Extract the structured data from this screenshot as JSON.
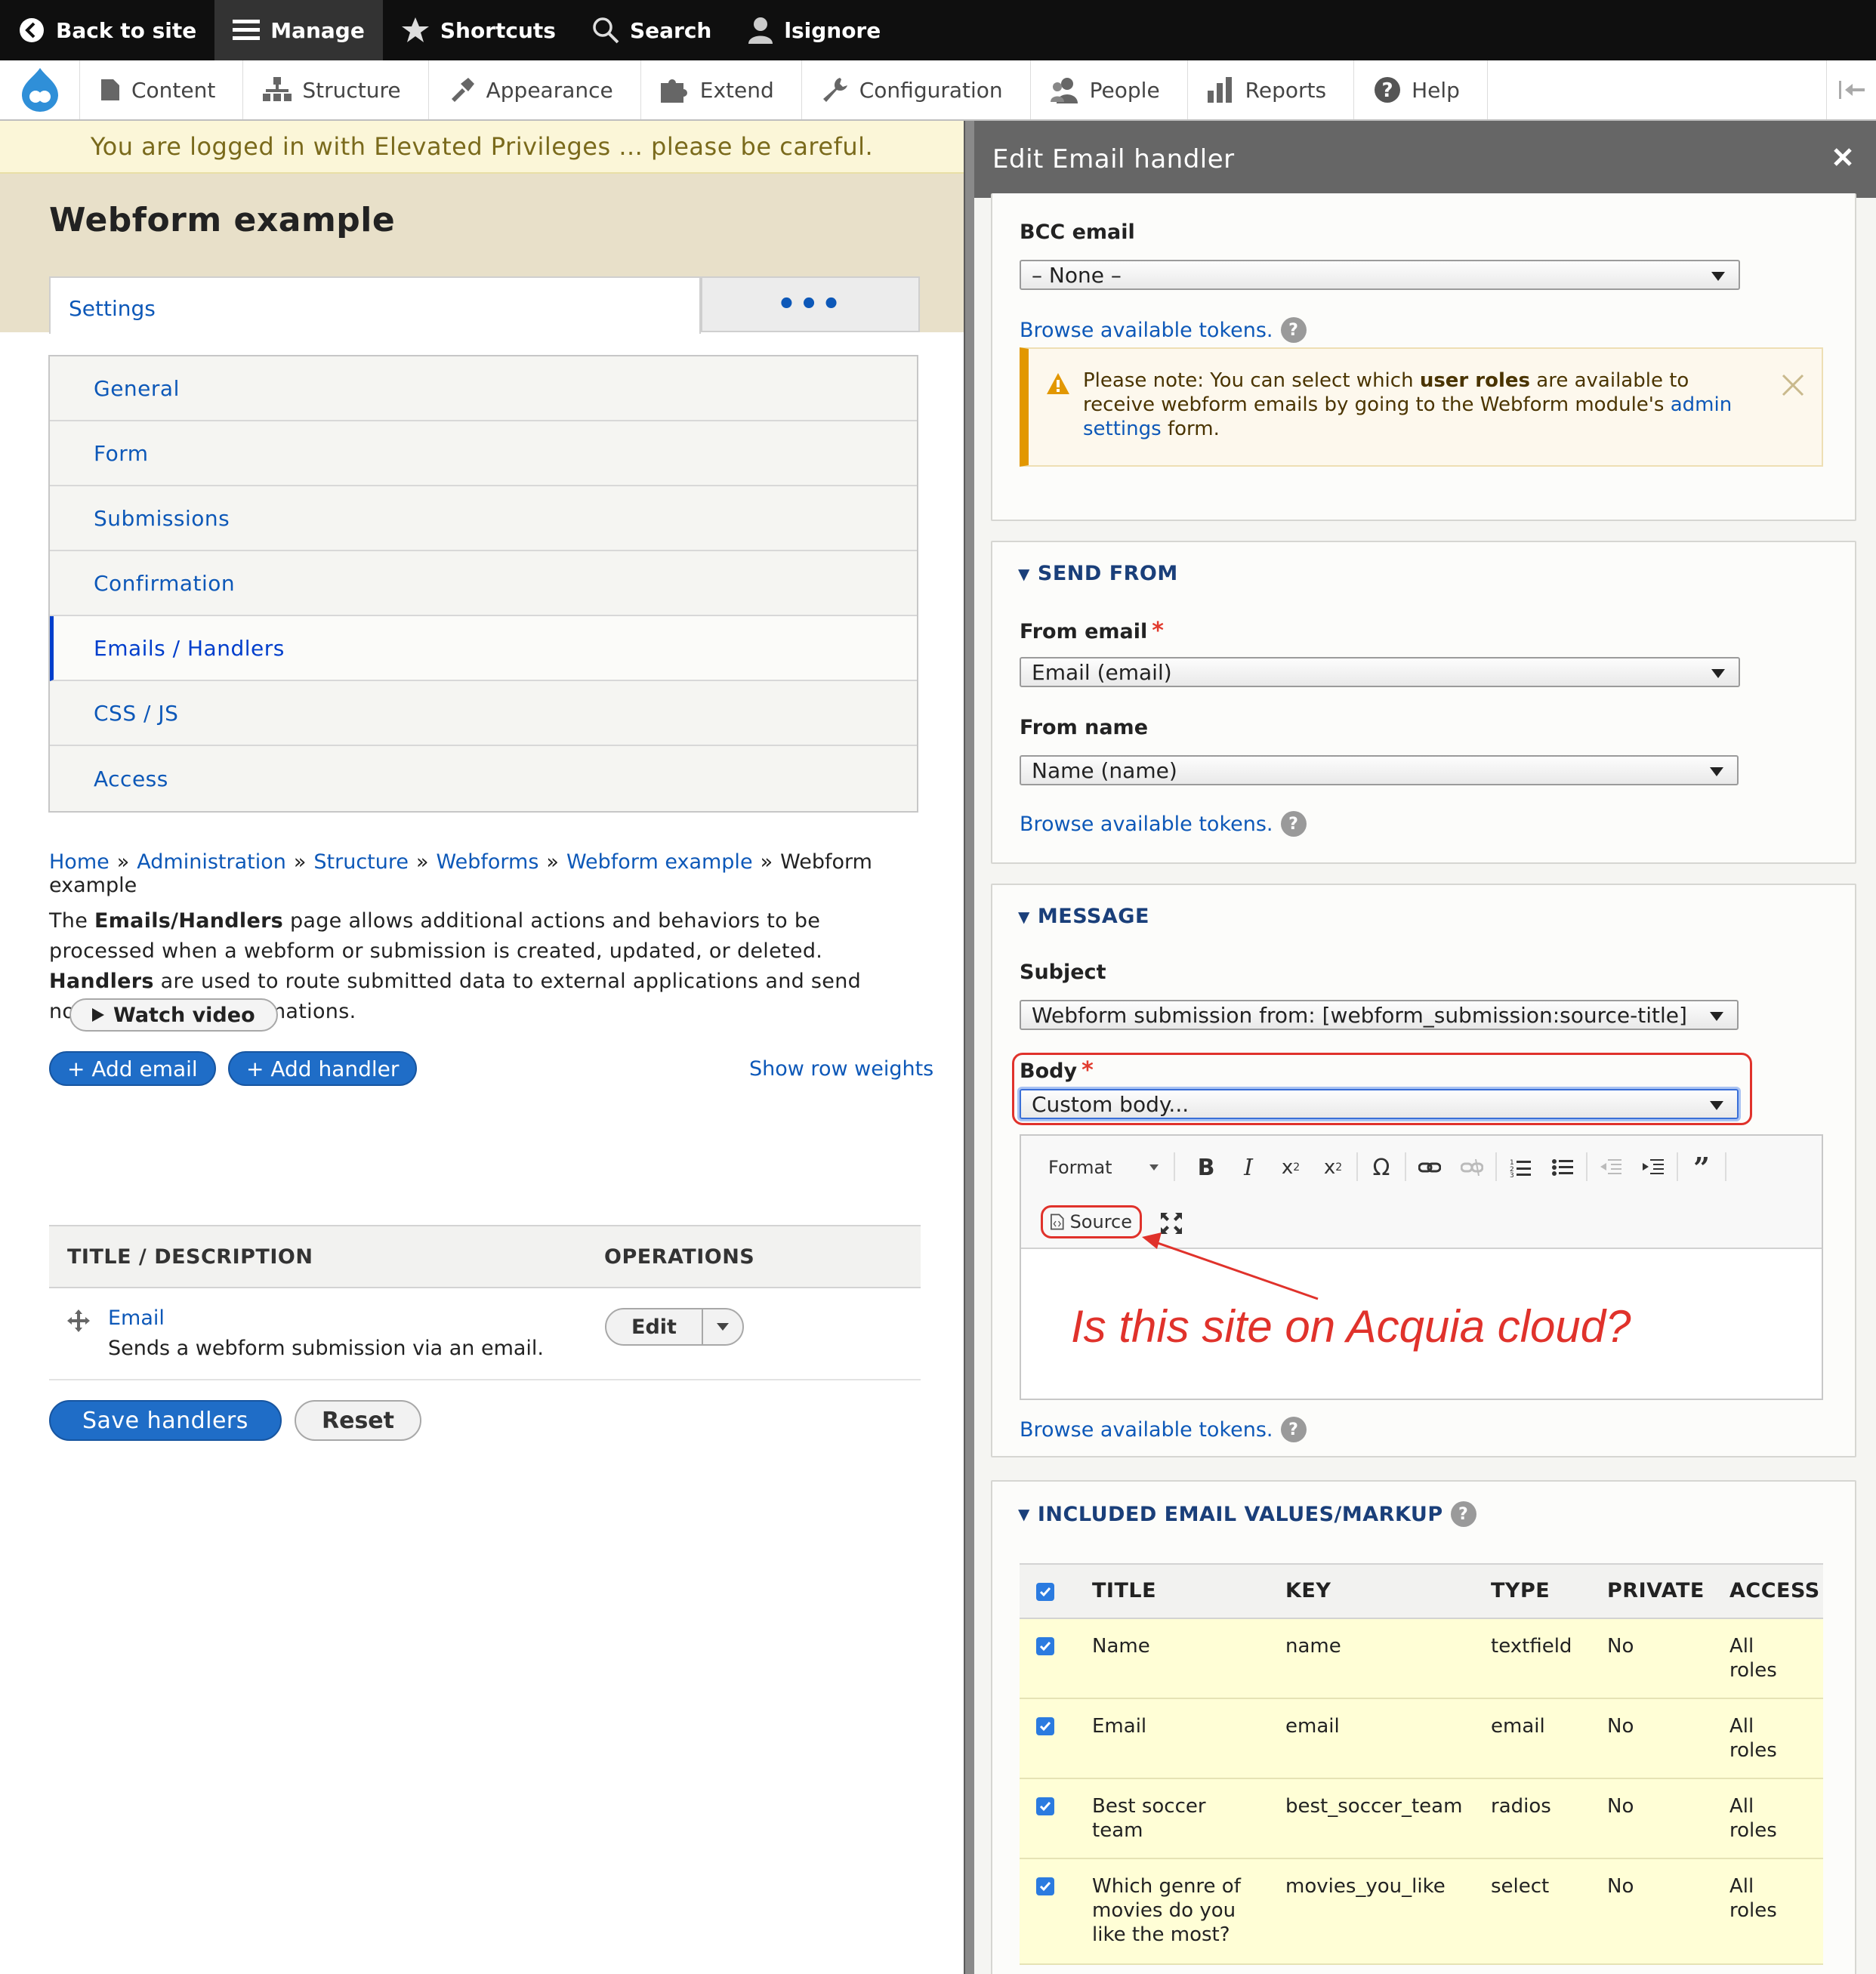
{
  "toolbar": {
    "back_to_site": "Back to site",
    "manage": "Manage",
    "shortcuts": "Shortcuts",
    "search": "Search",
    "user": "lsignore"
  },
  "tray": {
    "items": [
      "Content",
      "Structure",
      "Appearance",
      "Extend",
      "Configuration",
      "People",
      "Reports",
      "Help"
    ]
  },
  "left": {
    "warning": "You are logged in with Elevated Privileges ... please be careful.",
    "page_title": "Webform example",
    "tab_settings": "Settings",
    "tab_more": "•••",
    "vtabs": [
      "General",
      "Form",
      "Submissions",
      "Confirmation",
      "Emails / Handlers",
      "CSS / JS",
      "Access"
    ],
    "breadcrumb": [
      "Home",
      "Administration",
      "Structure",
      "Webforms",
      "Webform example"
    ],
    "breadcrumb_current": "Webform example",
    "breadcrumb_sep": "»",
    "intro": {
      "p1": "The ",
      "b1": "Emails/Handlers",
      "p2": " page allows additional actions and behaviors to be processed when a webform or submission is created, updated, or deleted. ",
      "b2": "Handlers",
      "p3": " are used to route submitted data to external applications and send notifications & confirmations."
    },
    "watch_video": "Watch video",
    "add_email": "+ Add email",
    "add_handler": "+ Add handler",
    "show_row_weights": "Show row weights",
    "table": {
      "col_title": "TITLE / DESCRIPTION",
      "col_operations": "OPERATIONS",
      "rows": [
        {
          "title": "Email",
          "description": "Sends a webform submission via an email.",
          "op": "Edit"
        }
      ]
    },
    "save_handlers": "Save handlers",
    "reset": "Reset"
  },
  "dialog": {
    "title": "Edit Email handler",
    "bcc_label": "BCC email",
    "bcc_value": "– None –",
    "browse_tokens": "Browse available tokens.",
    "note": {
      "prefix": "Please note: You can select which ",
      "bold": "user roles",
      "middle": " are available to receive webform emails by going to the Webform module's ",
      "link": "admin settings",
      "suffix": " form."
    },
    "send_from": {
      "legend": "SEND FROM",
      "from_email_label": "From email",
      "from_email_value": "Email (email)",
      "from_name_label": "From name",
      "from_name_value": "Name (name)"
    },
    "message": {
      "legend": "MESSAGE",
      "subject_label": "Subject",
      "subject_value": "Webform submission from: [webform_submission:source-title]",
      "body_label": "Body",
      "body_value": "Custom body...",
      "format_label": "Format",
      "source_label": "Source"
    },
    "annotation": "Is this site on Acquia cloud?",
    "included": {
      "legend": "INCLUDED EMAIL VALUES/MARKUP",
      "headers": [
        "TITLE",
        "KEY",
        "TYPE",
        "PRIVATE",
        "ACCESS"
      ],
      "rows": [
        {
          "title": "Name",
          "key": "name",
          "type": "textfield",
          "private": "No",
          "access": "All roles"
        },
        {
          "title": "Email",
          "key": "email",
          "type": "email",
          "private": "No",
          "access": "All roles"
        },
        {
          "title": "Best soccer team",
          "key": "best_soccer_team",
          "type": "radios",
          "private": "No",
          "access": "All roles"
        },
        {
          "title": "Which genre of movies do you like the most?",
          "key": "movies_you_like",
          "type": "select",
          "private": "No",
          "access": "All roles"
        }
      ]
    }
  },
  "colors": {
    "link": "#0d58b8",
    "primary_button": "#1f6dc7",
    "annotation_red": "#e0322b",
    "warning_bg": "#fbf6d8",
    "highlight_row": "#fffed6"
  }
}
